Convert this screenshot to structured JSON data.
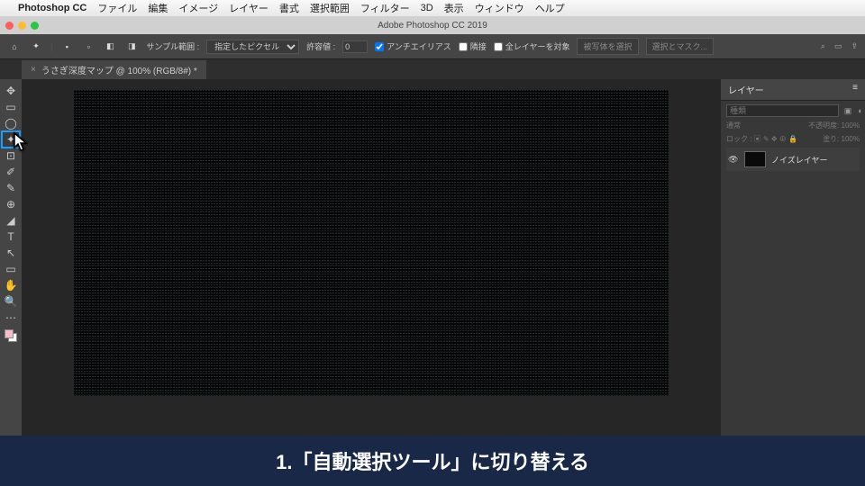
{
  "mac_menu": {
    "app": "Photoshop CC",
    "items": [
      "ファイル",
      "編集",
      "イメージ",
      "レイヤー",
      "書式",
      "選択範囲",
      "フィルター",
      "3D",
      "表示",
      "ウィンドウ",
      "ヘルプ"
    ]
  },
  "titlebar": "Adobe Photoshop CC 2019",
  "options": {
    "sample_label": "サンプル範囲 :",
    "sample_value": "指定したピクセル",
    "tolerance_label": "許容値 :",
    "tolerance_value": "0",
    "antialias": "アンチエイリアス",
    "contiguous": "隣接",
    "all_layers": "全レイヤーを対象",
    "select_subject": "被写体を選択",
    "select_mask": "選択とマスク..."
  },
  "doc_tab": "うさぎ深度マップ @ 100% (RGB/8#) *",
  "tools": [
    "↔",
    "▭",
    "◌",
    "✦",
    "⌖",
    "◔",
    "✎",
    "⊕",
    "⌫",
    "T",
    "▶",
    "⬚",
    "✋",
    "🔍",
    "⋯"
  ],
  "layers_panel": {
    "title": "レイヤー",
    "search_placeholder": "種類",
    "blend": "通常",
    "opacity_label": "不透明度:",
    "opacity_value": "100%",
    "lock_label": "ロック :",
    "fill_label": "塗り:",
    "fill_value": "100%",
    "layer_name": "ノイズレイヤー"
  },
  "caption": "1.「自動選択ツール」に切り替える"
}
